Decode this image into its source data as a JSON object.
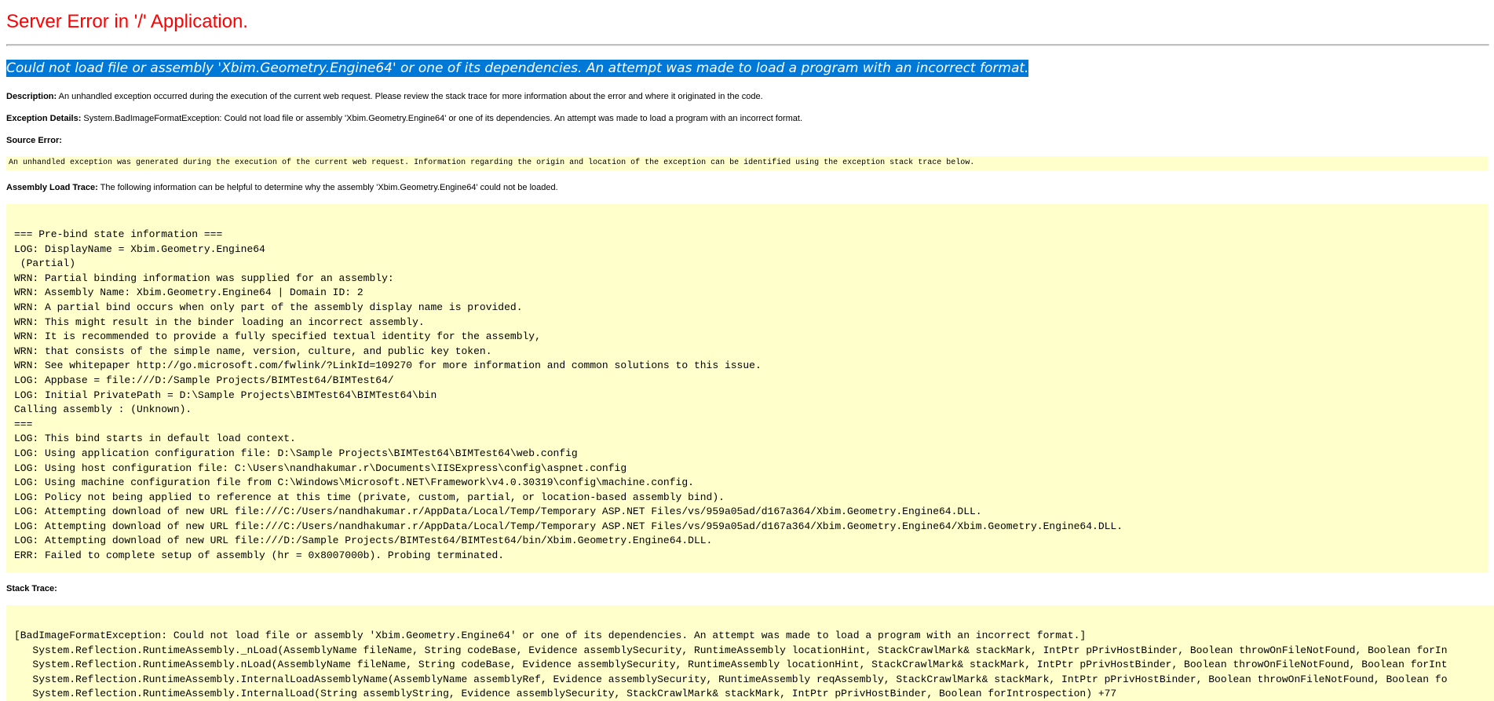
{
  "header": {
    "title": "Server Error in '/' Application."
  },
  "error": {
    "message": "Could not load file or assembly 'Xbim.Geometry.Engine64' or one of its dependencies. An attempt was made to load a program with an incorrect format."
  },
  "description": {
    "label": "Description:",
    "text": " An unhandled exception occurred during the execution of the current web request. Please review the stack trace for more information about the error and where it originated in the code."
  },
  "exception_details": {
    "label": "Exception Details:",
    "text": " System.BadImageFormatException: Could not load file or assembly 'Xbim.Geometry.Engine64' or one of its dependencies. An attempt was made to load a program with an incorrect format."
  },
  "source_error": {
    "label": "Source Error:",
    "text": "An unhandled exception was generated during the execution of the current web request. Information regarding the origin and location of the exception can be identified using the exception stack trace below."
  },
  "assembly_load_trace": {
    "label": "Assembly Load Trace:",
    "text": " The following information can be helpful to determine why the assembly 'Xbim.Geometry.Engine64' could not be loaded.",
    "lines": [
      "=== Pre-bind state information ===",
      "LOG: DisplayName = Xbim.Geometry.Engine64",
      " (Partial)",
      "WRN: Partial binding information was supplied for an assembly:",
      "WRN: Assembly Name: Xbim.Geometry.Engine64 | Domain ID: 2",
      "WRN: A partial bind occurs when only part of the assembly display name is provided.",
      "WRN: This might result in the binder loading an incorrect assembly.",
      "WRN: It is recommended to provide a fully specified textual identity for the assembly,",
      "WRN: that consists of the simple name, version, culture, and public key token.",
      "WRN: See whitepaper http://go.microsoft.com/fwlink/?LinkId=109270 for more information and common solutions to this issue.",
      "LOG: Appbase = file:///D:/Sample Projects/BIMTest64/BIMTest64/",
      "LOG: Initial PrivatePath = D:\\Sample Projects\\BIMTest64\\BIMTest64\\bin",
      "Calling assembly : (Unknown).",
      "===",
      "LOG: This bind starts in default load context.",
      "LOG: Using application configuration file: D:\\Sample Projects\\BIMTest64\\BIMTest64\\web.config",
      "LOG: Using host configuration file: C:\\Users\\nandhakumar.r\\Documents\\IISExpress\\config\\aspnet.config",
      "LOG: Using machine configuration file from C:\\Windows\\Microsoft.NET\\Framework\\v4.0.30319\\config\\machine.config.",
      "LOG: Policy not being applied to reference at this time (private, custom, partial, or location-based assembly bind).",
      "LOG: Attempting download of new URL file:///C:/Users/nandhakumar.r/AppData/Local/Temp/Temporary ASP.NET Files/vs/959a05ad/d167a364/Xbim.Geometry.Engine64.DLL.",
      "LOG: Attempting download of new URL file:///C:/Users/nandhakumar.r/AppData/Local/Temp/Temporary ASP.NET Files/vs/959a05ad/d167a364/Xbim.Geometry.Engine64/Xbim.Geometry.Engine64.DLL.",
      "LOG: Attempting download of new URL file:///D:/Sample Projects/BIMTest64/BIMTest64/bin/Xbim.Geometry.Engine64.DLL.",
      "ERR: Failed to complete setup of assembly (hr = 0x8007000b). Probing terminated."
    ]
  },
  "stack_trace": {
    "label": "Stack Trace:",
    "lines": [
      "[BadImageFormatException: Could not load file or assembly 'Xbim.Geometry.Engine64' or one of its dependencies. An attempt was made to load a program with an incorrect format.]",
      "   System.Reflection.RuntimeAssembly._nLoad(AssemblyName fileName, String codeBase, Evidence assemblySecurity, RuntimeAssembly locationHint, StackCrawlMark& stackMark, IntPtr pPrivHostBinder, Boolean throwOnFileNotFound, Boolean forIn",
      "   System.Reflection.RuntimeAssembly.nLoad(AssemblyName fileName, String codeBase, Evidence assemblySecurity, RuntimeAssembly locationHint, StackCrawlMark& stackMark, IntPtr pPrivHostBinder, Boolean throwOnFileNotFound, Boolean forInt",
      "   System.Reflection.RuntimeAssembly.InternalLoadAssemblyName(AssemblyName assemblyRef, Evidence assemblySecurity, RuntimeAssembly reqAssembly, StackCrawlMark& stackMark, IntPtr pPrivHostBinder, Boolean throwOnFileNotFound, Boolean fo",
      "   System.Reflection.RuntimeAssembly.InternalLoad(String assemblyString, Evidence assemblySecurity, StackCrawlMark& stackMark, IntPtr pPrivHostBinder, Boolean forIntrospection) +77"
    ]
  },
  "colors": {
    "title": "#ff0000",
    "error_message": "#800000",
    "selection_background": "#0078d7",
    "code_background": "#ffffcc",
    "rule": "#c0c0c0"
  }
}
